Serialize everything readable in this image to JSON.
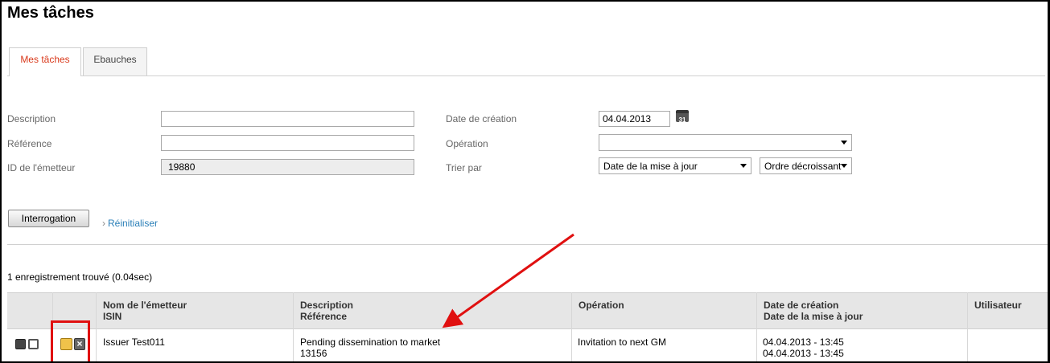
{
  "page": {
    "title": "Mes tâches"
  },
  "tabs": [
    {
      "label": "Mes tâches",
      "active": true
    },
    {
      "label": "Ebauches",
      "active": false
    }
  ],
  "form": {
    "description": {
      "label": "Description",
      "value": ""
    },
    "reference": {
      "label": "Référence",
      "value": ""
    },
    "issuer_id": {
      "label": "ID de l'émetteur",
      "value": "19880"
    },
    "creation_date": {
      "label": "Date de création",
      "value": "04.04.2013",
      "calendar_icon_text": "31"
    },
    "operation": {
      "label": "Opération",
      "value": ""
    },
    "sort_by": {
      "label": "Trier par",
      "value": "Date de la mise à jour",
      "order": "Ordre décroissant"
    }
  },
  "actions": {
    "query_button": "Interrogation",
    "reset_link": "Réinitialiser",
    "reset_chevron": "›"
  },
  "results": {
    "count_text": "1 enregistrement trouvé (0.04sec)"
  },
  "table": {
    "headers": {
      "issuer_name": "Nom de l'émetteur",
      "isin": "ISIN",
      "description": "Description",
      "reference": "Référence",
      "operation": "Opération",
      "creation_date": "Date de création",
      "update_date": "Date de la mise à jour",
      "user": "Utilisateur"
    },
    "rows": [
      {
        "issuer_name": "Issuer Test011",
        "description": "Pending dissemination to market",
        "reference": "13156",
        "operation": "Invitation to next GM",
        "creation_date": "04.04.2013 - 13:45",
        "update_date": "04.04.2013 - 13:45",
        "user": ""
      }
    ]
  },
  "annotation_color": "#e01010"
}
